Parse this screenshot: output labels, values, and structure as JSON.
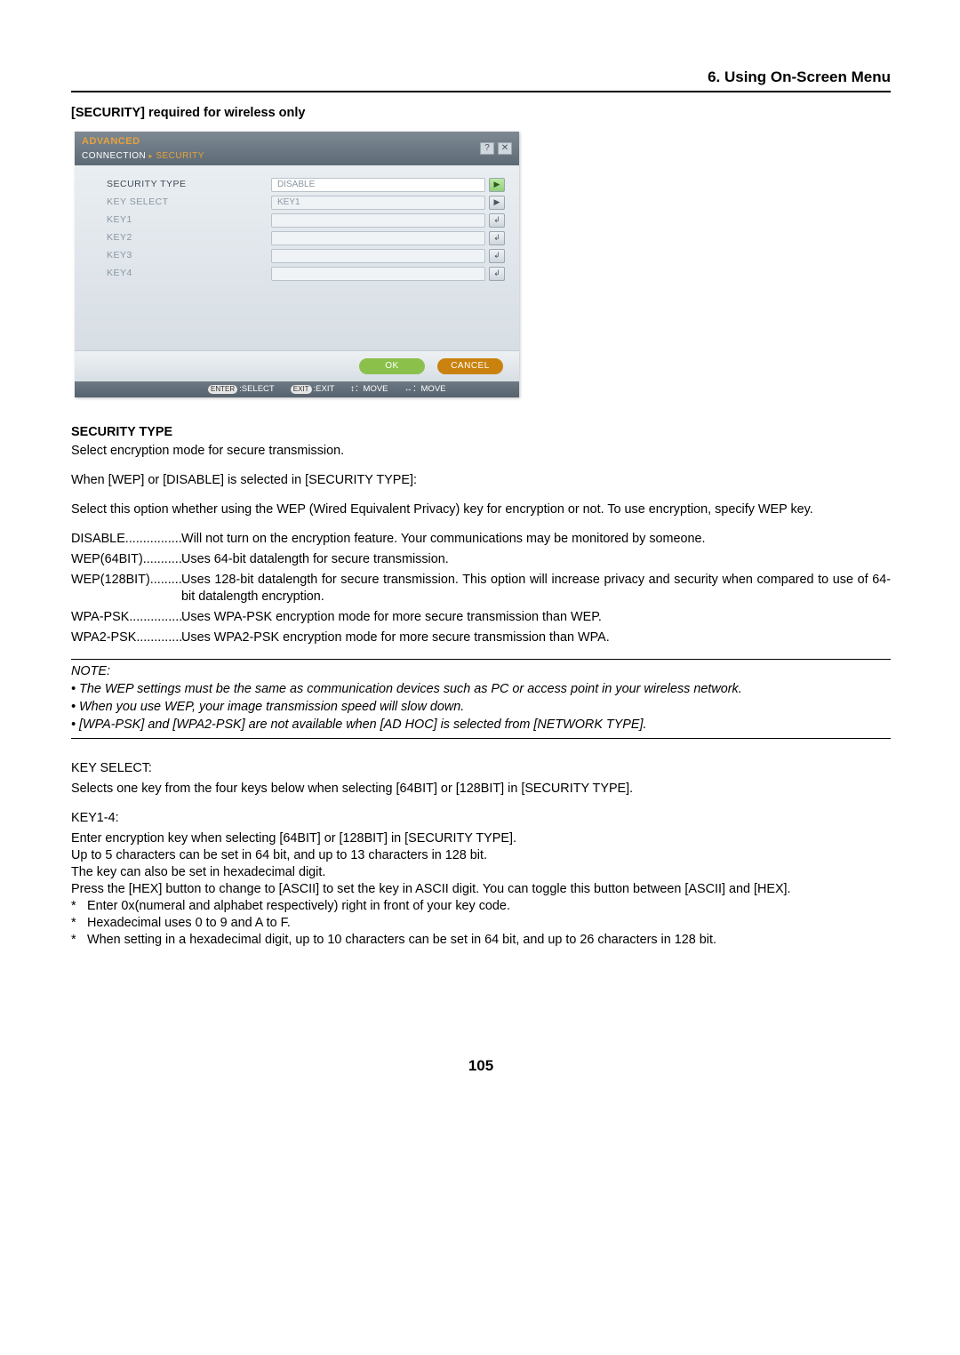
{
  "chapter": "6. Using On-Screen Menu",
  "section": "[SECURITY] required for wireless only",
  "osd": {
    "title": "ADVANCED",
    "breadcrumb_a": "CONNECTION",
    "breadcrumb_b": "SECURITY",
    "help_icon": "?",
    "close_icon": "✕",
    "rows": {
      "security_type": {
        "label": "SECURITY TYPE",
        "value": "DISABLE"
      },
      "key_select": {
        "label": "KEY SELECT",
        "value": "KEY1"
      },
      "key1": {
        "label": "KEY1",
        "value": ""
      },
      "key2": {
        "label": "KEY2",
        "value": ""
      },
      "key3": {
        "label": "KEY3",
        "value": ""
      },
      "key4": {
        "label": "KEY4",
        "value": ""
      }
    },
    "ok": "OK",
    "cancel": "CANCEL",
    "foot": {
      "enter": "ENTER",
      "select": ":SELECT",
      "exit": "EXIT",
      "exit_lbl": ":EXIT",
      "move1": "：MOVE",
      "move2": "：MOVE"
    }
  },
  "body": {
    "sec_type_h": "SECURITY TYPE",
    "sec_type_p": "Select encryption mode for secure transmission.",
    "when_wep": "When [WEP] or [DISABLE] is selected in [SECURITY TYPE]:",
    "select_opt": "Select this option whether using the WEP (Wired Equivalent Privacy) key for encryption or not. To use encryption, specify WEP key.",
    "defs": [
      {
        "term": "DISABLE",
        "dots": "................",
        "desc": "Will not turn on the encryption feature. Your communications may be monitored by someone."
      },
      {
        "term": "WEP(64BIT)",
        "dots": "...........",
        "desc": "Uses 64-bit datalength for secure transmission."
      },
      {
        "term": "WEP(128BIT)",
        "dots": ".........",
        "desc": "Uses 128-bit datalength for secure transmission. This option will increase privacy and security when compared to use of 64-bit datalength encryption."
      },
      {
        "term": "WPA-PSK",
        "dots": "...............",
        "desc": "Uses WPA-PSK encryption mode for more secure transmission than WEP."
      },
      {
        "term": "WPA2-PSK",
        "dots": ".............",
        "desc": "Uses WPA2-PSK encryption mode for more secure transmission than WPA."
      }
    ],
    "note_h": "NOTE:",
    "notes": [
      "The WEP settings must be the same as communication devices such as PC or access point in your wireless network.",
      "When you use WEP, your image transmission speed will slow down.",
      "[WPA-PSK] and [WPA2-PSK] are not available when [AD HOC] is selected from [NETWORK TYPE]."
    ],
    "key_select_h": "KEY SELECT:",
    "key_select_p": "Selects one key from the four keys below when selecting [64BIT] or [128BIT] in [SECURITY TYPE].",
    "key14_h": "KEY1-4:",
    "key14_lines": [
      "Enter encryption key when selecting [64BIT] or [128BIT] in [SECURITY TYPE].",
      "Up to 5 characters can be set in 64 bit, and up to 13 characters in 128 bit.",
      "The key can also be set in hexadecimal digit.",
      "Press the [HEX] button to change to [ASCII] to set the key in ASCII digit. You can toggle this button between [ASCII] and [HEX]."
    ],
    "stars": [
      "Enter 0x(numeral and alphabet respectively) right in front of your key code.",
      "Hexadecimal uses 0 to 9 and A to F.",
      "When setting in a hexadecimal digit, up to 10 characters can be set in 64 bit, and up to 26 characters in 128 bit."
    ]
  },
  "page_number": "105"
}
